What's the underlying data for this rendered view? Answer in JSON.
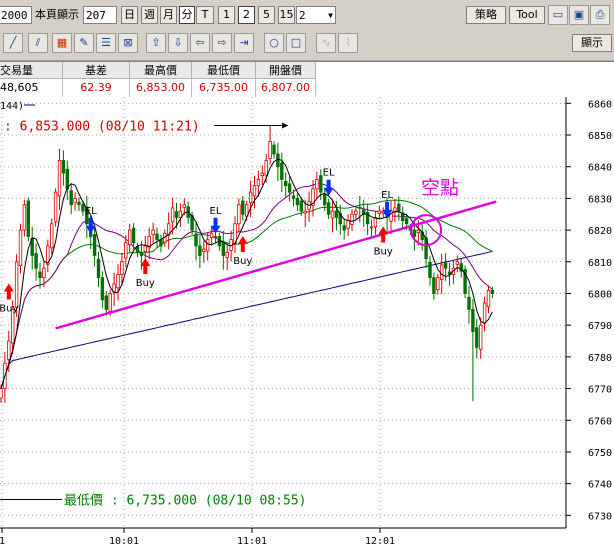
{
  "toolbar": {
    "code_value": "2000",
    "page_label": "本頁顯示",
    "page_count": "207",
    "periods": [
      "日",
      "週",
      "月",
      "分",
      "T",
      "1",
      "2",
      "5",
      "15"
    ],
    "interval_value": "2",
    "strategy_button": "策略",
    "tool_button": "Tool",
    "display_button": "顯示"
  },
  "quote": {
    "headers": [
      "交易量",
      "基差",
      "最高價",
      "最低價",
      "開盤價"
    ],
    "values": [
      "48,605",
      "62.39",
      "6,853.00",
      "6,735.00",
      "6,807.00"
    ]
  },
  "colors": {
    "up": "#dd0000",
    "down": "#007000",
    "ma_short": "#000000",
    "ma_mid": "#800080",
    "ma_long": "#008000",
    "ma_longest": "#000080",
    "trendline": "#e000e0",
    "arrow_up": "#ff0000",
    "arrow_down": "#0030ff",
    "low_text": "#008000",
    "high_text": "#d00000"
  },
  "chart_data": {
    "type": "candlestick",
    "ma_tag": "144)",
    "y_ticks": [
      6860,
      6850,
      6840,
      6830,
      6820,
      6810,
      6800,
      6790,
      6780,
      6770,
      6760,
      6750,
      6740,
      6730
    ],
    "ylim": [
      6726,
      6862
    ],
    "x_ticks": [
      "1",
      "10:01",
      "11:01",
      "12:01"
    ],
    "high_annotation": ": 6,853.000 (08/10 11:21)",
    "low_annotation": "最低價 : 6,735.000 (08/10 08:55)",
    "callout": "空點",
    "signals": [
      {
        "label": "Buy",
        "type": "buy",
        "bar": 2,
        "value": 6800
      },
      {
        "label": "EL",
        "type": "exit",
        "bar": 23,
        "value": 6822
      },
      {
        "label": "Buy",
        "type": "buy",
        "bar": 37,
        "value": 6808
      },
      {
        "label": "EL",
        "type": "exit",
        "bar": 55,
        "value": 6822
      },
      {
        "label": "Buy",
        "type": "buy",
        "bar": 62,
        "value": 6815
      },
      {
        "label": "EL",
        "type": "exit",
        "bar": 84,
        "value": 6834
      },
      {
        "label": "Buy",
        "type": "buy",
        "bar": 98,
        "value": 6818
      },
      {
        "label": "EL",
        "type": "exit",
        "bar": 99,
        "value": 6827
      }
    ],
    "trendline": {
      "from": {
        "bar": 14,
        "value": 6789
      },
      "to": {
        "bar": 127,
        "value": 6829
      }
    },
    "closes": [
      6770,
      6778,
      6785,
      6795,
      6810,
      6820,
      6828,
      6818,
      6812,
      6808,
      6805,
      6808,
      6815,
      6822,
      6832,
      6842,
      6838,
      6833,
      6828,
      6830,
      6828,
      6826,
      6822,
      6818,
      6812,
      6805,
      6798,
      6795,
      6800,
      6803,
      6806,
      6810,
      6816,
      6820,
      6816,
      6813,
      6812,
      6815,
      6818,
      6820,
      6817,
      6815,
      6819,
      6822,
      6827,
      6824,
      6826,
      6828,
      6824,
      6820,
      6815,
      6812,
      6814,
      6817,
      6819,
      6818,
      6815,
      6812,
      6813,
      6817,
      6822,
      6828,
      6825,
      6828,
      6832,
      6834,
      6836,
      6838,
      6842,
      6848,
      6844,
      6840,
      6836,
      6834,
      6832,
      6830,
      6828,
      6826,
      6826,
      6829,
      6833,
      6836,
      6832,
      6828,
      6825,
      6826,
      6824,
      6822,
      6820,
      6823,
      6825,
      6826,
      6827,
      6825,
      6822,
      6821,
      6824,
      6826,
      6826,
      6824,
      6826,
      6827,
      6826,
      6823,
      6822,
      6820,
      6818,
      6820,
      6817,
      6811,
      6805,
      6800,
      6805,
      6809,
      6808,
      6806,
      6808,
      6810,
      6807,
      6800,
      6795,
      6788,
      6783,
      6790,
      6797,
      6801,
      6800
    ]
  }
}
